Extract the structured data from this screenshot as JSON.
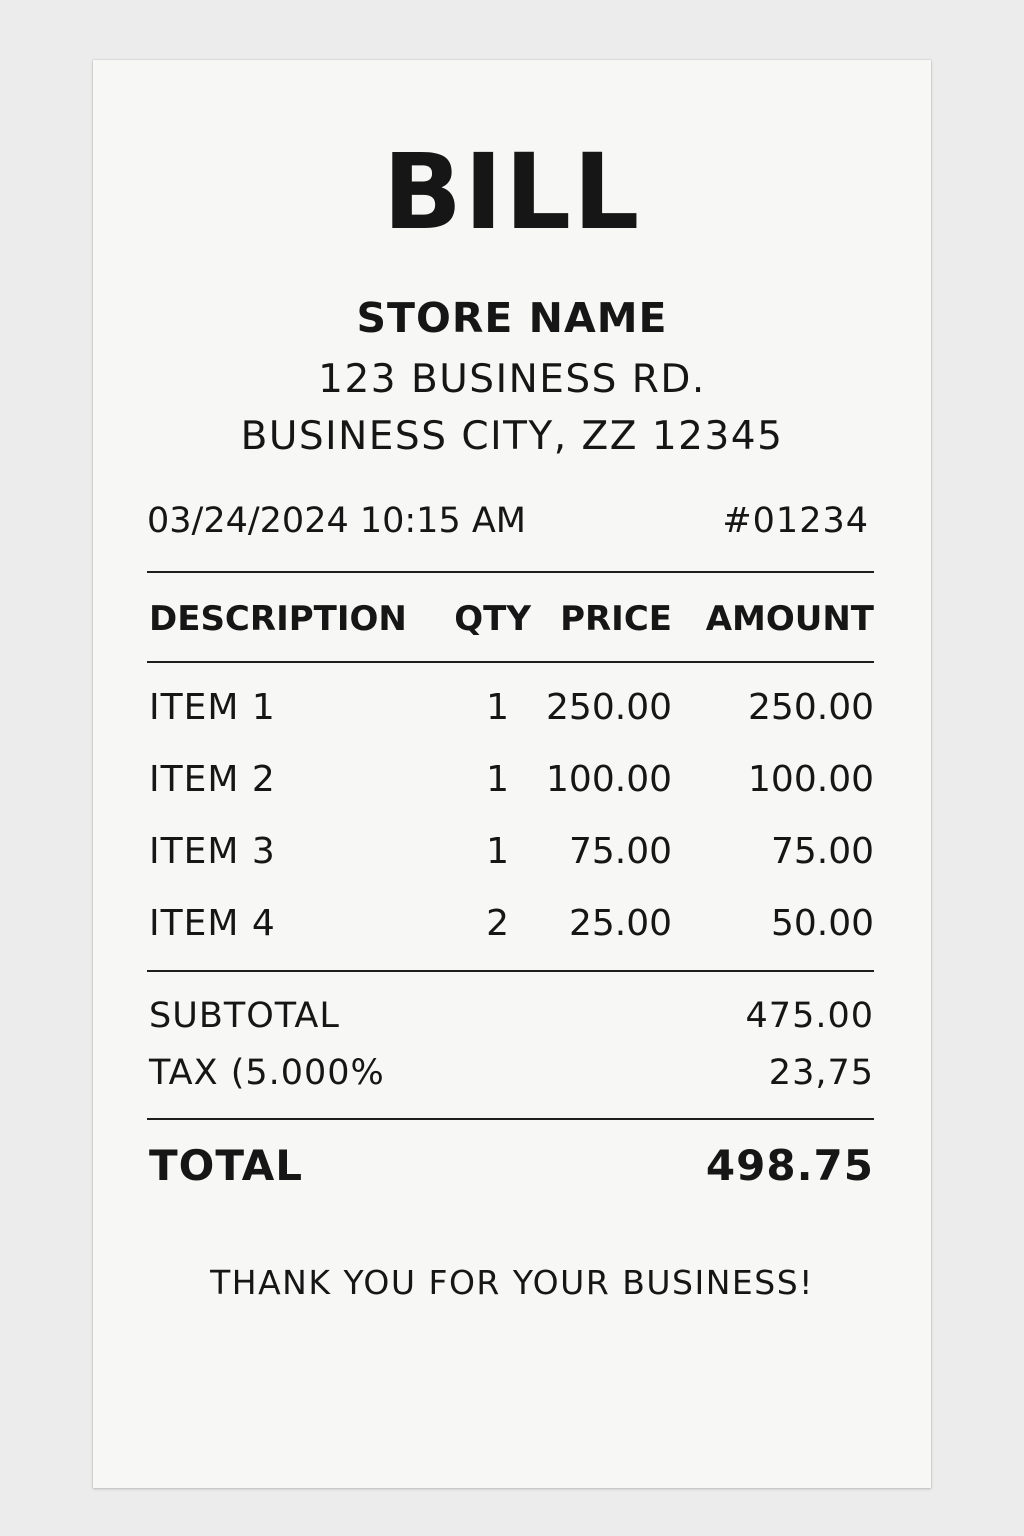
{
  "receipt": {
    "title": "BILL",
    "store_name": "STORE NAME",
    "address_line1": "123 BUSINESS RD.",
    "address_line2": "BUSINESS CITY, ZZ 12345",
    "datetime": "03/24/2024 10:15 AM",
    "number": "#01234",
    "columns": {
      "description": "DESCRIPTION",
      "qty": "QTY",
      "price": "PRICE",
      "amount": "AMOUNT"
    },
    "items": [
      {
        "description": "ITEM 1",
        "qty": "1",
        "price": "250.00",
        "amount": "250.00"
      },
      {
        "description": "ITEM 2",
        "qty": "1",
        "price": "100.00",
        "amount": "100.00"
      },
      {
        "description": "ITEM 3",
        "qty": "1",
        "price": "75.00",
        "amount": "75.00"
      },
      {
        "description": "ITEM 4",
        "qty": "2",
        "price": "25.00",
        "amount": "50.00"
      }
    ],
    "subtotal_label": "SUBTOTAL",
    "subtotal_value": "475.00",
    "tax_label": "TAX (5.000%",
    "tax_value": "23,75",
    "total_label": "TOTAL",
    "total_value": "498.75",
    "footer": "THANK YOU FOR YOUR BUSINESS!"
  }
}
